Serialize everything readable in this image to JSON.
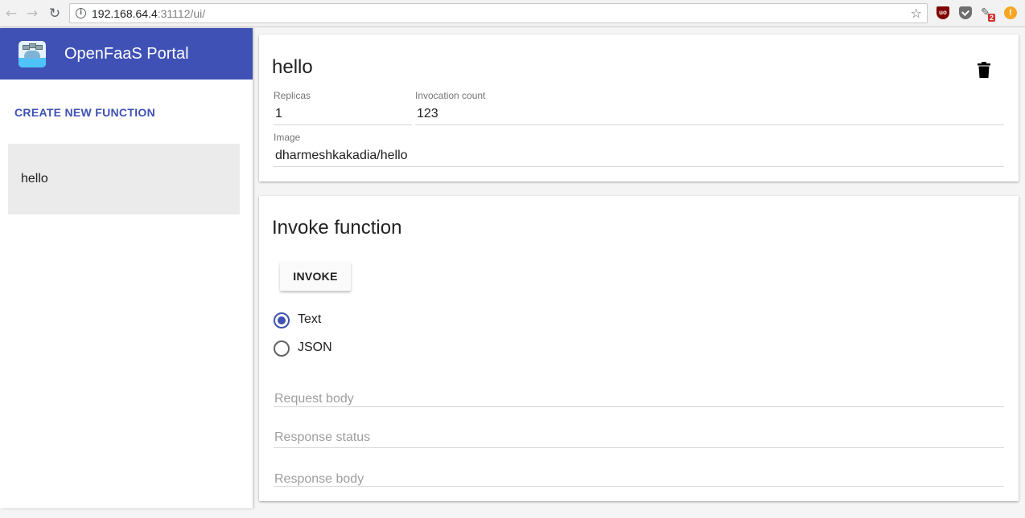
{
  "browser": {
    "url_host": "192.168.64.4",
    "url_rest": ":31112/ui/",
    "extension_badge": "2"
  },
  "sidebar": {
    "app_title": "OpenFaaS Portal",
    "create_label": "CREATE NEW FUNCTION",
    "functions": [
      {
        "label": "hello"
      }
    ]
  },
  "detail": {
    "function_name": "hello",
    "replicas_label": "Replicas",
    "replicas_value": "1",
    "invocation_label": "Invocation count",
    "invocation_value": "123",
    "image_label": "Image",
    "image_value": "dharmeshkakadia/hello"
  },
  "invoke": {
    "title": "Invoke function",
    "button_label": "INVOKE",
    "options": [
      {
        "label": "Text",
        "selected": true
      },
      {
        "label": "JSON",
        "selected": false
      }
    ],
    "request_placeholder": "Request body",
    "response_status_placeholder": "Response status",
    "response_body_placeholder": "Response body"
  },
  "colors": {
    "primary": "#3f51b5"
  }
}
